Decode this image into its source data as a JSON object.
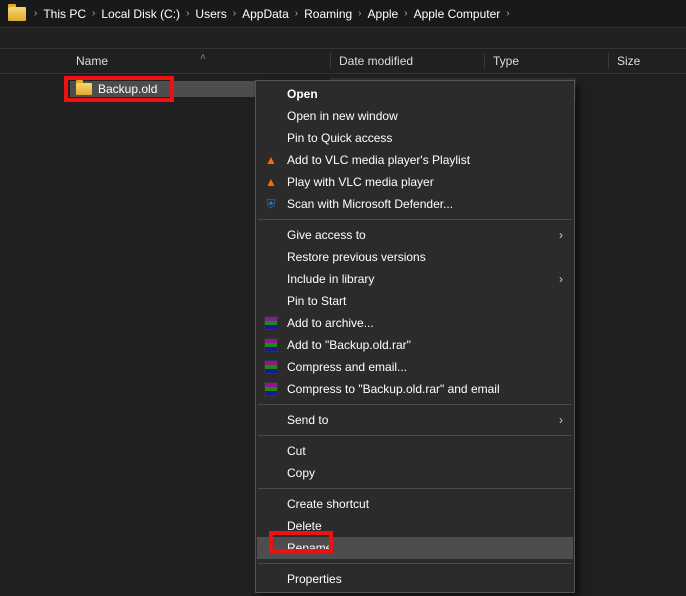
{
  "breadcrumb": [
    "This PC",
    "Local Disk (C:)",
    "Users",
    "AppData",
    "Roaming",
    "Apple",
    "Apple Computer"
  ],
  "columns": {
    "name": "Name",
    "date": "Date modified",
    "type": "Type",
    "size": "Size"
  },
  "row": {
    "name": "Backup.old"
  },
  "ctx": {
    "open": "Open",
    "open_new": "Open in new window",
    "pin_qa": "Pin to Quick access",
    "vlc_add": "Add to VLC media player's Playlist",
    "vlc_play": "Play with VLC media player",
    "defender": "Scan with Microsoft Defender...",
    "give_access": "Give access to",
    "restore": "Restore previous versions",
    "include_lib": "Include in library",
    "pin_start": "Pin to Start",
    "add_archive": "Add to archive...",
    "add_rar": "Add to \"Backup.old.rar\"",
    "compress_email": "Compress and email...",
    "compress_rar_email": "Compress to \"Backup.old.rar\" and email",
    "send_to": "Send to",
    "cut": "Cut",
    "copy": "Copy",
    "shortcut": "Create shortcut",
    "delete": "Delete",
    "rename": "Rename",
    "properties": "Properties"
  }
}
